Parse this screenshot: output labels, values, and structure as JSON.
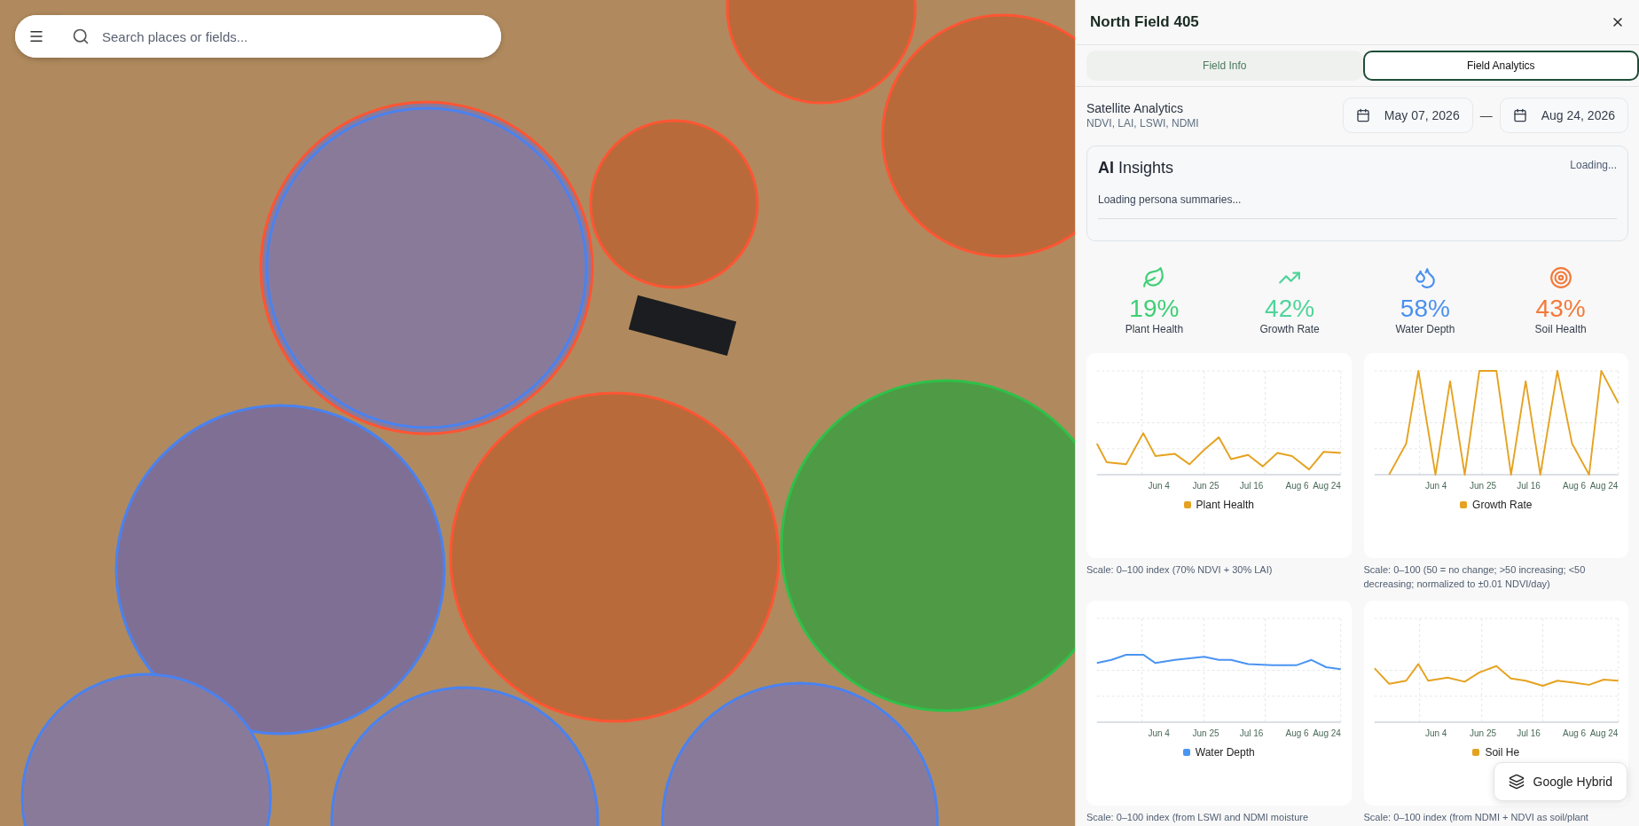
{
  "search": {
    "placeholder": "Search places or fields..."
  },
  "panel": {
    "title": "North Field 405"
  },
  "tabs": [
    {
      "label": "Field Info",
      "selected": false
    },
    {
      "label": "Field Analytics",
      "selected": true
    }
  ],
  "analytics": {
    "title": "Satellite Analytics",
    "subtitle": "NDVI, LAI, LSWI, NDMI",
    "start_date": "May 07, 2026",
    "separator": "—",
    "end_date": "Aug 24, 2026"
  },
  "insights": {
    "title_bold": "AI",
    "title_rest": "Insights",
    "status": "Loading...",
    "message": "Loading persona summaries..."
  },
  "metrics": [
    {
      "value": "19%",
      "label": "Plant Health",
      "color": "#3ecf74"
    },
    {
      "value": "42%",
      "label": "Growth Rate",
      "color": "#4fd49a"
    },
    {
      "value": "58%",
      "label": "Water Depth",
      "color": "#4a90f0"
    },
    {
      "value": "43%",
      "label": "Soil Health",
      "color": "#f37a3c"
    }
  ],
  "charts": [
    {
      "legend": "Plant Health",
      "color": "#e5a220",
      "xticks": [
        "Jun 4",
        "Jun 25",
        "Jul 16",
        "Aug 6",
        "Aug 24"
      ],
      "caption": "Scale: 0–100 index (70% NDVI + 30% LAI)"
    },
    {
      "legend": "Growth Rate",
      "color": "#e5a220",
      "xticks": [
        "Jun 4",
        "Jun 25",
        "Jul 16",
        "Aug 6",
        "Aug 24"
      ],
      "caption": "Scale: 0–100 (50 = no change; >50 increasing; <50 decreasing; normalized to ±0.01 NDVI/day)"
    },
    {
      "legend": "Water Depth",
      "color": "#4a94f2",
      "xticks": [
        "Jun 4",
        "Jun 25",
        "Jul 16",
        "Aug 6",
        "Aug 24"
      ],
      "caption": "Scale: 0–100 index (from LSWI and NDMI moisture"
    },
    {
      "legend": "Soil He",
      "color": "#e5a220",
      "xticks": [
        "Jun 4",
        "Jun 25",
        "Jul 16",
        "Aug 6",
        "Aug 24"
      ],
      "caption": "Scale: 0–100 index (from NDMI + NDVI as soil/plant"
    }
  ],
  "layer_button": {
    "label": "Google Hybrid"
  }
}
